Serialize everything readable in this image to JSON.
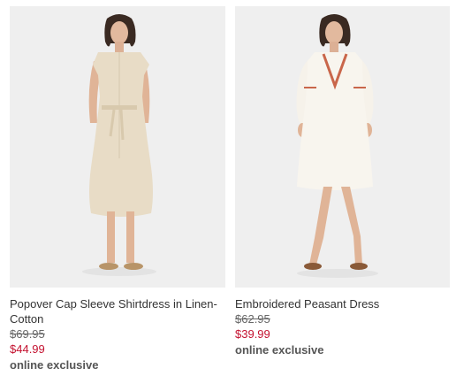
{
  "products": [
    {
      "name": "Popover Cap Sleeve Shirtdress in Linen-Cotton",
      "original_price": "$69.95",
      "sale_price": "$44.99",
      "badge": "online exclusive",
      "image_alt": "Model wearing a beige linen shirtdress with tie waist and slide sandals"
    },
    {
      "name": "Embroidered Peasant Dress",
      "original_price": "$62.95",
      "sale_price": "$39.99",
      "badge": "online exclusive",
      "image_alt": "Model wearing a white peasant dress with red embroidered trim and brown sandals"
    }
  ],
  "colors": {
    "image_background": "#efefef",
    "sale_price": "#c41230",
    "text": "#333333",
    "strike_price": "#666666"
  }
}
